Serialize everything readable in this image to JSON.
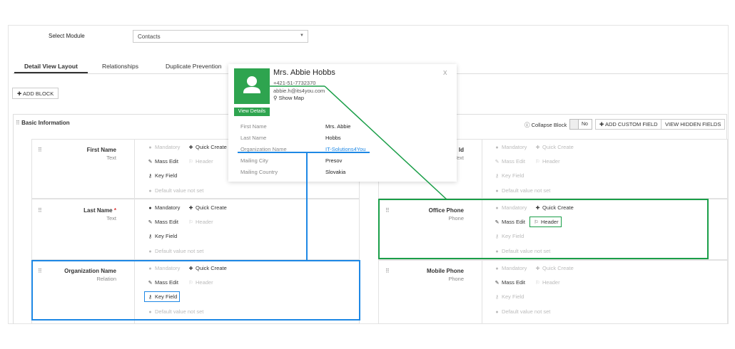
{
  "header": {
    "select_label": "Select Module",
    "module_value": "Contacts"
  },
  "tabs": [
    {
      "label": "Detail View Layout",
      "active": true
    },
    {
      "label": "Relationships",
      "active": false
    },
    {
      "label": "Duplicate Prevention",
      "active": false
    }
  ],
  "toolbar": {
    "add_block_label": "ADD BLOCK"
  },
  "block": {
    "title": "Basic Information",
    "collapse_label": "Collapse Block",
    "collapse_value": "No",
    "add_custom_field_label": "ADD CUSTOM FIELD",
    "view_hidden_fields_label": "VIEW HIDDEN FIELDS"
  },
  "options": {
    "mandatory": "Mandatory",
    "quick_create": "Quick Create",
    "mass_edit": "Mass Edit",
    "header": "Header",
    "key_field": "Key Field",
    "default_value": "Default value not set"
  },
  "fields_left": [
    {
      "name": "First Name",
      "required": false,
      "type": "Text"
    },
    {
      "name": "Last Name",
      "required": true,
      "type": "Text"
    },
    {
      "name": "Organization Name",
      "required": false,
      "type": "Relation"
    }
  ],
  "fields_right": [
    {
      "name": "Id",
      "type": "Text"
    },
    {
      "name": "Office Phone",
      "type": "Phone"
    },
    {
      "name": "Mobile Phone",
      "type": "Phone"
    }
  ],
  "required_marker": "*",
  "popup": {
    "name": "Mrs. Abbie Hobbs",
    "phone": "+421-51-7732370",
    "email": "abbie.h@its4you.com",
    "show_map": "Show Map",
    "view_details": "View Details",
    "close": "x",
    "rows": [
      {
        "key": "First Name",
        "value": "Mrs. Abbie"
      },
      {
        "key": "Last Name",
        "value": "Hobbs"
      },
      {
        "key": "Organization Name",
        "value": "IT-Solutions4You"
      },
      {
        "key": "Mailing City",
        "value": "Presov"
      },
      {
        "key": "Mailing Country",
        "value": "Slovakia"
      }
    ]
  },
  "colors": {
    "accent_green": "#2ea44f",
    "highlight_green": "#1a9e48",
    "highlight_blue": "#1e88e5"
  }
}
